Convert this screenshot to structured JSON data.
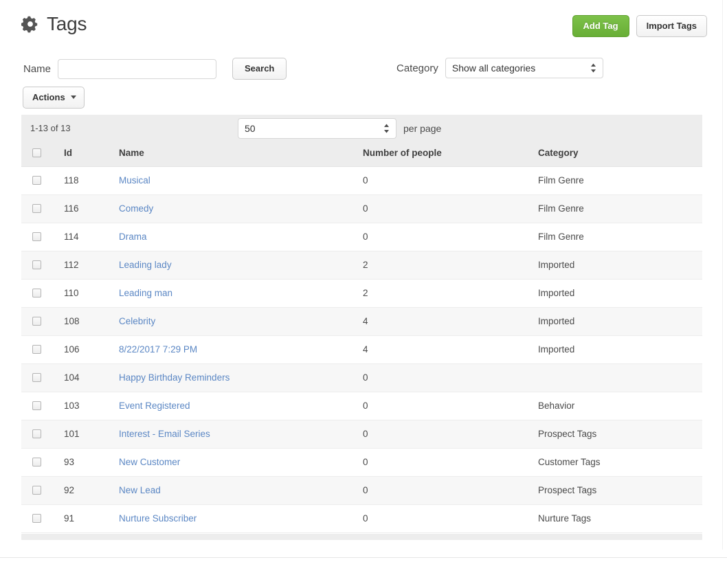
{
  "header": {
    "title": "Tags",
    "gear_icon": "gear-icon",
    "buttons": {
      "add_tag": "Add Tag",
      "import_tags": "Import Tags"
    }
  },
  "filters": {
    "name_label": "Name",
    "name_value": "",
    "name_placeholder": "",
    "search_button": "Search",
    "category_label": "Category",
    "category_selected": "Show all categories",
    "category_options": [
      "Show all categories"
    ]
  },
  "toolbar": {
    "actions_label": "Actions",
    "caret_icon": "caret-down-icon"
  },
  "table": {
    "count_text": "1-13 of 13",
    "per_page_selected": "50",
    "per_page_options": [
      "50"
    ],
    "per_page_label": "per page",
    "columns": [
      "",
      "Id",
      "Name",
      "Number of people",
      "Category"
    ],
    "rows": [
      {
        "id": "118",
        "name": "Musical",
        "people": "0",
        "category": "Film Genre"
      },
      {
        "id": "116",
        "name": "Comedy",
        "people": "0",
        "category": "Film Genre"
      },
      {
        "id": "114",
        "name": "Drama",
        "people": "0",
        "category": "Film Genre"
      },
      {
        "id": "112",
        "name": "Leading lady",
        "people": "2",
        "category": "Imported"
      },
      {
        "id": "110",
        "name": "Leading man",
        "people": "2",
        "category": "Imported"
      },
      {
        "id": "108",
        "name": "Celebrity",
        "people": "4",
        "category": "Imported"
      },
      {
        "id": "106",
        "name": "8/22/2017 7:29 PM",
        "people": "4",
        "category": "Imported"
      },
      {
        "id": "104",
        "name": "Happy Birthday Reminders",
        "people": "0",
        "category": ""
      },
      {
        "id": "103",
        "name": "Event Registered",
        "people": "0",
        "category": "Behavior"
      },
      {
        "id": "101",
        "name": "Interest - Email Series",
        "people": "0",
        "category": "Prospect Tags"
      },
      {
        "id": "93",
        "name": "New Customer",
        "people": "0",
        "category": "Customer Tags"
      },
      {
        "id": "92",
        "name": "New Lead",
        "people": "0",
        "category": "Prospect Tags"
      },
      {
        "id": "91",
        "name": "Nurture Subscriber",
        "people": "0",
        "category": "Nurture Tags"
      }
    ]
  },
  "colors": {
    "accent_green": "#72b83f",
    "link_blue": "#5b87c4",
    "header_gray": "#ededed",
    "stripe_gray": "#f7f7f7",
    "text_dark": "#3d3d3d"
  }
}
